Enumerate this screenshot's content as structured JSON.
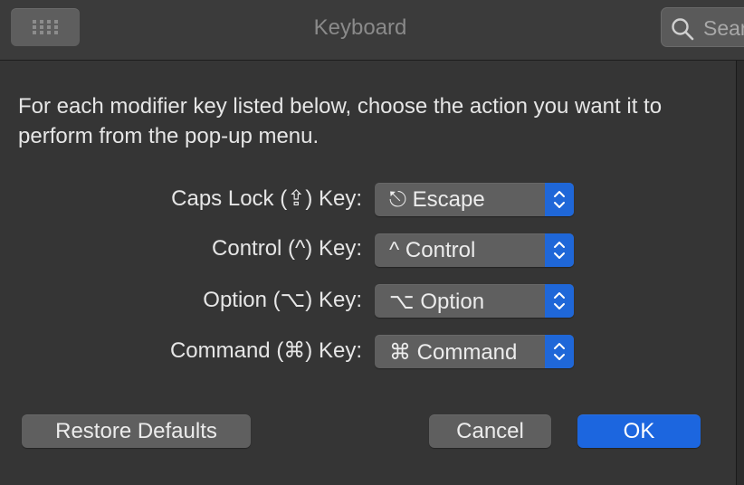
{
  "window": {
    "title": "Keyboard"
  },
  "search": {
    "placeholder": "Sear"
  },
  "dialog": {
    "description": "For each modifier key listed below, choose the action you want it to perform from the pop-up menu.",
    "rows": [
      {
        "label": "Caps Lock (⇪) Key:",
        "value": "⎋ Escape",
        "icon": "escape-icon"
      },
      {
        "label": "Control (^) Key:",
        "value": "^ Control",
        "icon": "control-icon"
      },
      {
        "label": "Option (⌥) Key:",
        "value": "⌥ Option",
        "icon": "option-icon"
      },
      {
        "label": "Command (⌘) Key:",
        "value": "⌘ Command",
        "icon": "command-icon"
      }
    ],
    "buttons": {
      "restore": "Restore Defaults",
      "cancel": "Cancel",
      "ok": "OK"
    }
  },
  "colors": {
    "accent": "#1c66df",
    "background": "#353535",
    "popup": "#5f5f5f"
  }
}
